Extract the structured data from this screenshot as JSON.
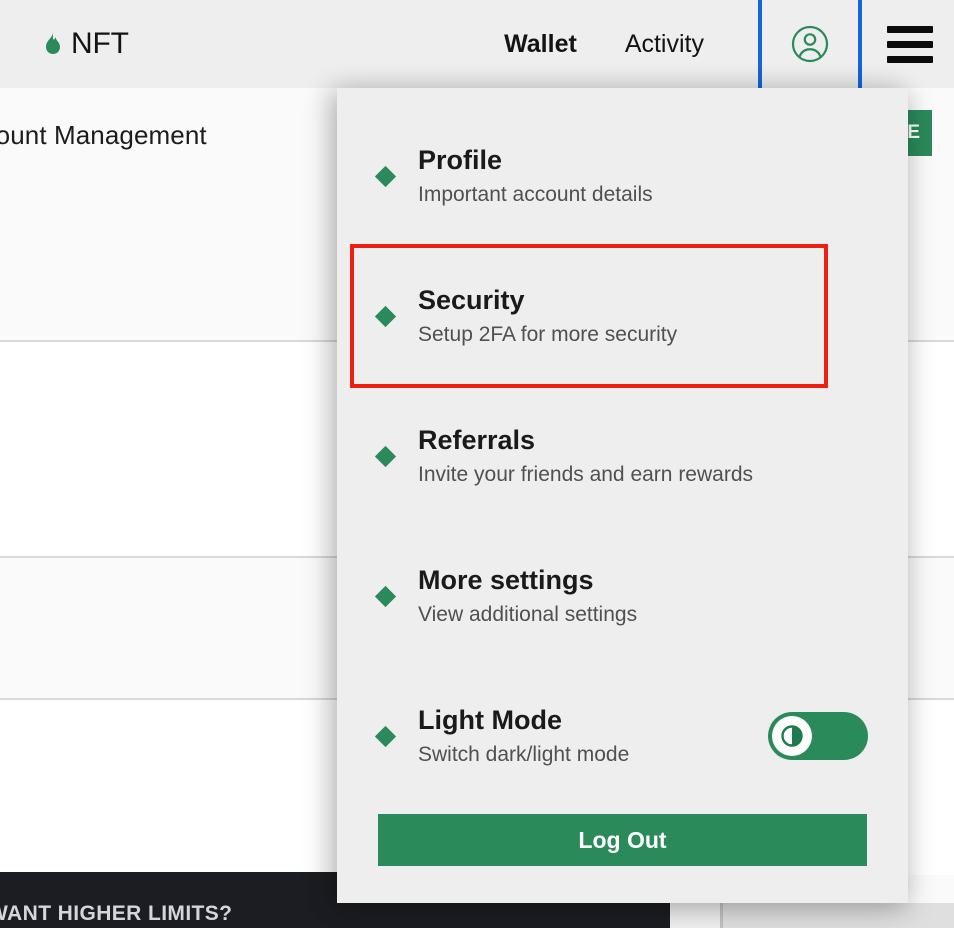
{
  "header": {
    "brand": {
      "name": "NFT",
      "icon": "flame-icon",
      "color": "#2b8a5a"
    },
    "nav": [
      {
        "label": "Wallet",
        "name": "nav-link-wallet"
      },
      {
        "label": "Activity",
        "name": "nav-link-activity"
      }
    ],
    "avatar": {
      "icon": "user-circle-icon",
      "color": "#2b8a5a",
      "focus_color": "#1565d8"
    },
    "menu_toggle": {
      "icon": "hamburger-icon"
    }
  },
  "background": {
    "page_title": "Account Management",
    "cta_label": "E",
    "promo_text": "WANT HIGHER LIMITS?"
  },
  "dropdown": {
    "items": [
      {
        "title": "Profile",
        "subtitle": "Important account details",
        "name": "menu-item-profile",
        "highlighted": false
      },
      {
        "title": "Security",
        "subtitle": "Setup 2FA for more security",
        "name": "menu-item-security",
        "highlighted": true
      },
      {
        "title": "Referrals",
        "subtitle": "Invite your friends and earn rewards",
        "name": "menu-item-referrals",
        "highlighted": false
      },
      {
        "title": "More settings",
        "subtitle": "View additional settings",
        "name": "menu-item-more-settings",
        "highlighted": false
      },
      {
        "title": "Light Mode",
        "subtitle": "Switch dark/light mode",
        "name": "menu-item-light-mode",
        "highlighted": false,
        "toggle": {
          "state": "on",
          "icon": "contrast-icon"
        }
      }
    ],
    "logout_label": "Log Out",
    "accent_color": "#2b8a5a",
    "highlight_color": "#ee1f11"
  }
}
